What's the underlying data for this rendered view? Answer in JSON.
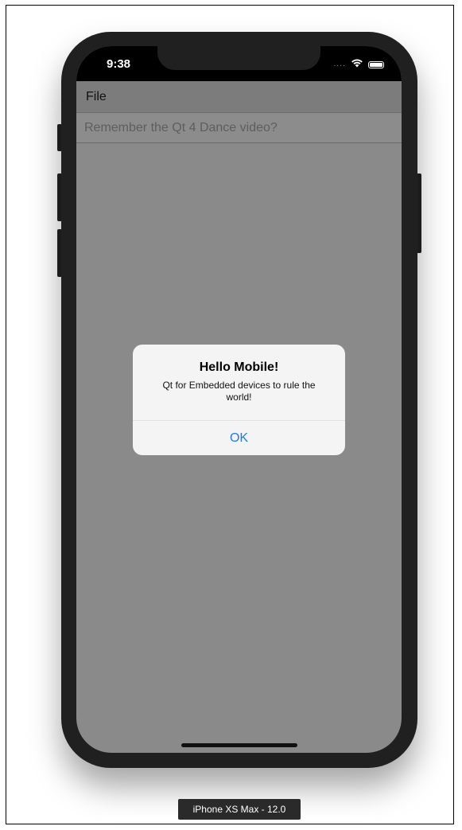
{
  "statusbar": {
    "time": "9:38",
    "signal_icon": "signal-dots-icon",
    "wifi_icon": "wifi-icon",
    "battery_icon": "battery-icon",
    "signal_text": "...."
  },
  "menubar": {
    "file_label": "File"
  },
  "text_input": {
    "value": "Remember the Qt 4 Dance video?"
  },
  "alert": {
    "title": "Hello Mobile!",
    "message": "Qt for Embedded devices to rule the world!",
    "ok_label": "OK"
  },
  "device": {
    "label": "iPhone XS Max - 12.0"
  },
  "colors": {
    "accent": "#1a7cf5",
    "screen_bg": "#8a8a8a",
    "phone_body": "#202020"
  }
}
